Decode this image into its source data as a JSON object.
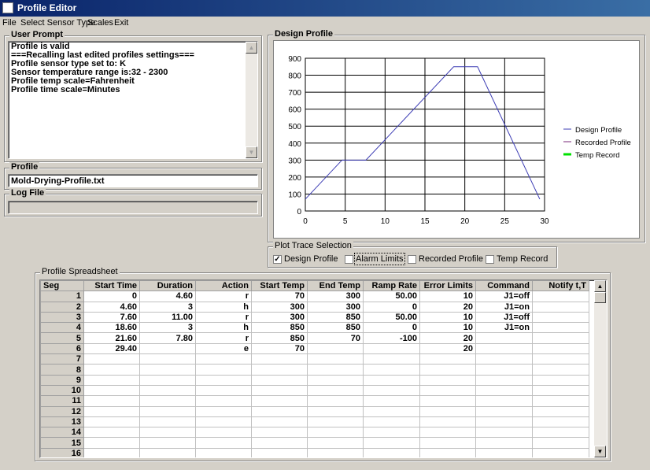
{
  "window": {
    "title": "Profile Editor"
  },
  "menu": [
    "File",
    "Select Sensor Type",
    "Scales",
    "Exit"
  ],
  "user_prompt": {
    "label": "User Prompt",
    "lines": [
      "Profile is valid",
      "===Recalling last edited profiles settings===",
      "Profile sensor type set to: K",
      "Sensor temperature range is:32 - 2300",
      "Profile temp scale=Fahrenheit",
      "Profile time scale=Minutes"
    ]
  },
  "profile": {
    "label": "Profile",
    "value": "Mold-Drying-Profile.txt"
  },
  "log_file": {
    "label": "Log File",
    "value": ""
  },
  "design_profile": {
    "label": "Design Profile"
  },
  "chart_data": {
    "type": "line",
    "title": "",
    "xlabel": "",
    "ylabel": "",
    "xlim": [
      0,
      30
    ],
    "ylim": [
      0,
      900
    ],
    "x_ticks": [
      "0",
      "5",
      "10",
      "15",
      "20",
      "25",
      "30"
    ],
    "y_ticks": [
      "0",
      "100",
      "200",
      "300",
      "400",
      "500",
      "600",
      "700",
      "800",
      "900"
    ],
    "grid": true,
    "legend_position": "right",
    "legend": [
      "Design Profile",
      "Recorded Profile",
      "Temp Record"
    ],
    "series": [
      {
        "name": "Design Profile",
        "color": "#3c3cb4",
        "x": [
          0,
          4.6,
          7.6,
          18.6,
          21.6,
          29.4
        ],
        "y": [
          70,
          300,
          300,
          850,
          850,
          70
        ]
      },
      {
        "name": "Recorded Profile",
        "color": "#7a2a7a",
        "x": [],
        "y": []
      },
      {
        "name": "Temp Record",
        "color": "#00e000",
        "x": [],
        "y": []
      }
    ]
  },
  "plot_trace": {
    "label": "Plot Trace Selection",
    "options": [
      {
        "label": "Design Profile",
        "checked": true
      },
      {
        "label": "Alarm Limits",
        "checked": false
      },
      {
        "label": "Recorded Profile",
        "checked": false
      },
      {
        "label": "Temp Record",
        "checked": false
      }
    ]
  },
  "spreadsheet": {
    "label": "Profile Spreadsheet",
    "headers": [
      "Seg",
      "Start Time",
      "Duration",
      "Action",
      "Start Temp",
      "End Temp",
      "Ramp Rate",
      "Error Limits",
      "Command",
      "Notify t,T"
    ],
    "rows": [
      [
        "1",
        "0",
        "4.60",
        "r",
        "70",
        "300",
        "50.00",
        "10",
        "J1=off",
        ""
      ],
      [
        "2",
        "4.60",
        "3",
        "h",
        "300",
        "300",
        "0",
        "20",
        "J1=on",
        ""
      ],
      [
        "3",
        "7.60",
        "11.00",
        "r",
        "300",
        "850",
        "50.00",
        "10",
        "J1=off",
        ""
      ],
      [
        "4",
        "18.60",
        "3",
        "h",
        "850",
        "850",
        "0",
        "10",
        "J1=on",
        ""
      ],
      [
        "5",
        "21.60",
        "7.80",
        "r",
        "850",
        "70",
        "-100",
        "20",
        "",
        ""
      ],
      [
        "6",
        "29.40",
        "",
        "e",
        "70",
        "",
        "",
        "20",
        "",
        ""
      ],
      [
        "7",
        "",
        "",
        "",
        "",
        "",
        "",
        "",
        "",
        ""
      ],
      [
        "8",
        "",
        "",
        "",
        "",
        "",
        "",
        "",
        "",
        ""
      ],
      [
        "9",
        "",
        "",
        "",
        "",
        "",
        "",
        "",
        "",
        ""
      ],
      [
        "10",
        "",
        "",
        "",
        "",
        "",
        "",
        "",
        "",
        ""
      ],
      [
        "11",
        "",
        "",
        "",
        "",
        "",
        "",
        "",
        "",
        ""
      ],
      [
        "12",
        "",
        "",
        "",
        "",
        "",
        "",
        "",
        "",
        ""
      ],
      [
        "13",
        "",
        "",
        "",
        "",
        "",
        "",
        "",
        "",
        ""
      ],
      [
        "14",
        "",
        "",
        "",
        "",
        "",
        "",
        "",
        "",
        ""
      ],
      [
        "15",
        "",
        "",
        "",
        "",
        "",
        "",
        "",
        "",
        ""
      ],
      [
        "16",
        "",
        "",
        "",
        "",
        "",
        "",
        "",
        "",
        ""
      ]
    ]
  }
}
